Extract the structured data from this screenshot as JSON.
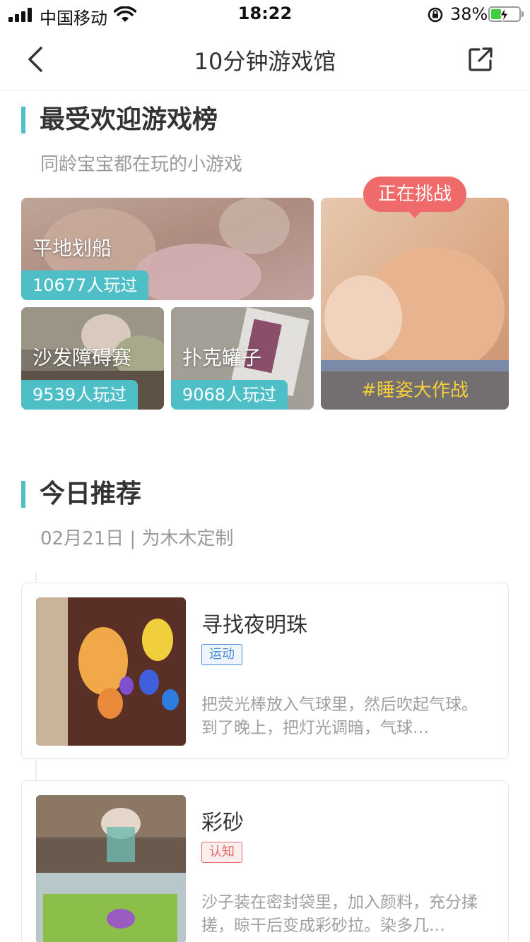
{
  "status_bar": {
    "carrier": "中国移动",
    "time": "18:22",
    "battery_percent": "38%",
    "battery_level": 0.38,
    "icons": [
      "signal-icon",
      "wifi-icon",
      "rotation-lock-icon",
      "battery-charging-icon"
    ]
  },
  "nav": {
    "title": "10分钟游戏馆",
    "icons": [
      "back-arrow-icon",
      "share-external-icon"
    ]
  },
  "popular": {
    "title": "最受欢迎游戏榜",
    "subtitle": "同龄宝宝都在玩的小游戏",
    "games": [
      {
        "name": "平地划船",
        "plays": "10677人玩过"
      },
      {
        "name": "沙发障碍赛",
        "plays": "9539人玩过"
      },
      {
        "name": "扑克罐子",
        "plays": "9068人玩过"
      }
    ],
    "challenge": {
      "badge": "正在挑战",
      "tag": "#睡姿大作战"
    }
  },
  "recommend": {
    "title": "今日推荐",
    "subtitle": "02月21日 | 为木木定制",
    "cards": [
      {
        "title": "寻找夜明珠",
        "tag": "运动",
        "tag_color": "#4a8fd6",
        "desc": "把荧光棒放入气球里，然后吹起气球。到了晚上，把灯光调暗，气球…"
      },
      {
        "title": "彩砂",
        "tag": "认知",
        "tag_color": "#e46a6a",
        "desc": "沙子装在密封袋里，加入颜料，充分揉搓，晾干后变成彩砂拉。染多几…"
      }
    ]
  },
  "colors": {
    "accent": "#4fbfc7",
    "challenge_badge": "#ef6a6a",
    "challenge_tag_text": "#f3cd3a"
  }
}
